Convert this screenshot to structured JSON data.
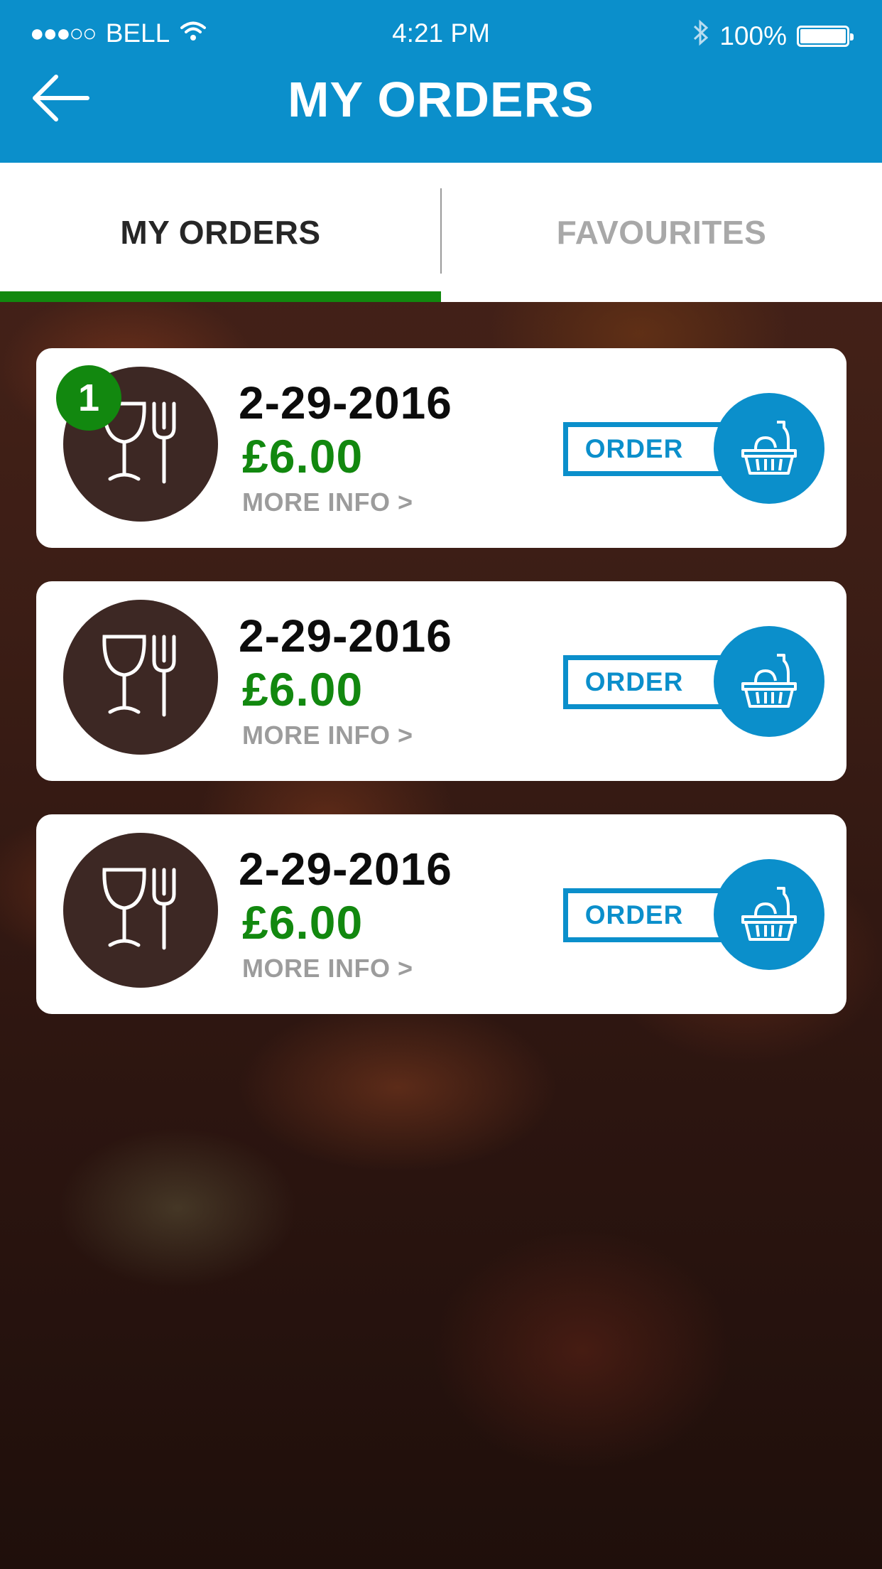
{
  "status_bar": {
    "signal": "●●●○○",
    "carrier": "BELL",
    "time": "4:21 PM",
    "battery": "100%",
    "icons": [
      "wifi-icon",
      "bluetooth-icon",
      "battery-icon"
    ]
  },
  "header": {
    "title": "MY ORDERS",
    "back_icon": "back-arrow-icon"
  },
  "tabs": [
    {
      "label": "MY ORDERS",
      "active": true
    },
    {
      "label": "FAVOURITES",
      "active": false
    }
  ],
  "orders": [
    {
      "badge": "1",
      "date": "2-29-2016",
      "price": "£6.00",
      "more_info": "MORE INFO >",
      "order_label": "ORDER"
    },
    {
      "date": "2-29-2016",
      "price": "£6.00",
      "more_info": "MORE INFO >",
      "order_label": "ORDER"
    },
    {
      "date": "2-29-2016",
      "price": "£6.00",
      "more_info": "MORE INFO >",
      "order_label": "ORDER"
    }
  ],
  "colors": {
    "primary_blue": "#0b8fcb",
    "accent_green": "#12880f",
    "avatar_brown": "#3d2824"
  }
}
